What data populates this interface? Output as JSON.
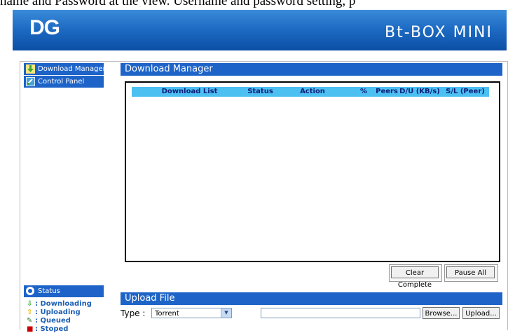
{
  "caption": "name and Password at the view. Username and password setting, p",
  "header": {
    "logo": "DG",
    "product": "Bt-BOX MINI"
  },
  "sidebar": {
    "items": [
      {
        "label": "Download Manager"
      },
      {
        "label": "Control Panel"
      }
    ],
    "status": {
      "title": "Status",
      "legend": [
        {
          "label": ": Downloading",
          "icon": "down-arrow-icon",
          "color": "#3aa53a"
        },
        {
          "label": ": Uploading",
          "icon": "up-arrow-icon",
          "color": "#e8b400"
        },
        {
          "label": ": Queued",
          "icon": "queued-icon",
          "color": "#2e7d32"
        },
        {
          "label": ": Stoped",
          "icon": "stop-icon",
          "color": "#cc0000"
        }
      ]
    }
  },
  "download_manager": {
    "title": "Download Manager",
    "columns": [
      "Download List",
      "Status",
      "Action",
      "%",
      "Peers",
      "D/U (KB/s)",
      "S/L (Peer)"
    ],
    "clear_button": "Clear Complete",
    "pause_button": "Pause All"
  },
  "upload": {
    "title": "Upload File",
    "type_label": "Type :",
    "type_value": "Torrent",
    "browse_button": "Browse...",
    "upload_button": "Upload..."
  },
  "colors": {
    "accent": "#1e64c8",
    "list_header": "#4dc0f2"
  }
}
